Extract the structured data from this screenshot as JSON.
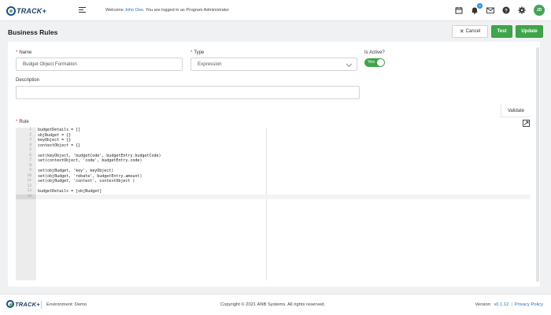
{
  "app": {
    "logo_text": "TRACK+"
  },
  "header": {
    "welcome_prefix": "Welcome ",
    "user_name": "John Doe",
    "welcome_suffix": ". You are logged in as Program Administrator",
    "notification_count": "0",
    "avatar_initials": "JD",
    "icons": [
      "calendar-icon",
      "bell-icon",
      "mail-icon",
      "help-icon",
      "gear-icon"
    ]
  },
  "page": {
    "title": "Business Rules",
    "cancel_label": "Cancel",
    "test_label": "Test",
    "update_label": "Update"
  },
  "form": {
    "name_label": "Name",
    "name_value": "Budget Object Formation",
    "type_label": "Type",
    "type_value": "Expression",
    "is_active_label": "Is Active?",
    "is_active_value": "Yes",
    "description_label": "Description",
    "description_value": "",
    "rule_label": "Rule",
    "validate_label": "Validate"
  },
  "editor": {
    "active_line": 14,
    "lines": [
      "budgetDetails = []",
      "objBudget = {}",
      "keyObject = {}",
      "contextObject = {}",
      "",
      "set(keyObject, 'budgetCode', budgetEntry.budgetCode)",
      "set(contextObject, 'code', budgetEntry.code)",
      "",
      "set(objBudget, 'key', keyObject)",
      "set(objBudget, 'rebate', budgetEntry.amount)",
      "set(objBudget, 'context', contextObject )",
      "",
      "budgetDetails = [objBudget]",
      ""
    ]
  },
  "footer": {
    "logo_text": "TRACK+",
    "environment": "Environment: Demo",
    "copyright": "Copyright © 2021 ANB Systems. All rights reserved.",
    "version_label": "Version:",
    "version_value": "v0.1.12",
    "separator": "|",
    "privacy_label": "Privacy Policy"
  },
  "colors": {
    "primary_green": "#3fa54a",
    "link_blue": "#2a6ebd",
    "required_red": "#d9342b",
    "logo_navy": "#1f3d63"
  }
}
